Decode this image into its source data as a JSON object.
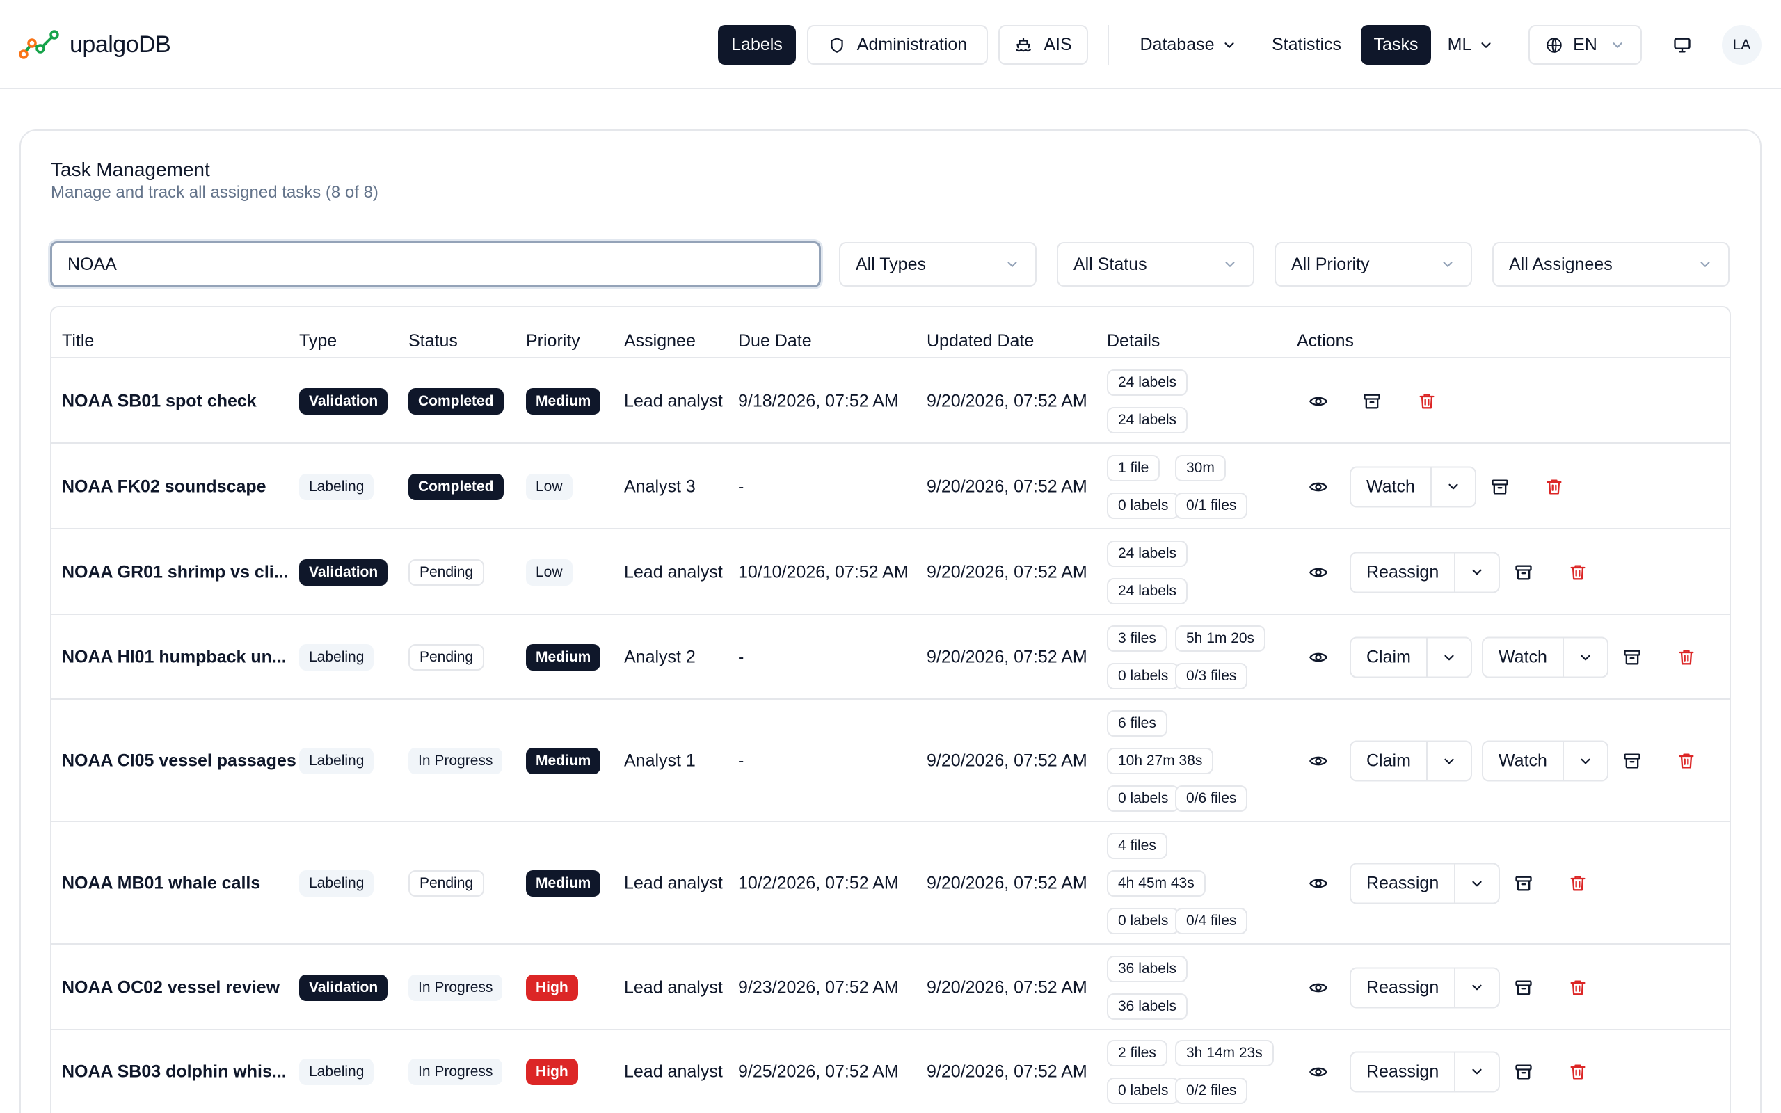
{
  "app": {
    "name": "upalgoDB"
  },
  "nav": {
    "labels": "Labels",
    "administration": "Administration",
    "ais": "AIS",
    "database": "Database",
    "statistics": "Statistics",
    "tasks": "Tasks",
    "ml": "ML",
    "language": "EN",
    "user_initials": "LA"
  },
  "page": {
    "title": "Task Management",
    "subtitle": "Manage and track all assigned tasks (8 of 8)"
  },
  "filters": {
    "search_value": "NOAA",
    "type": "All Types",
    "status": "All Status",
    "priority": "All Priority",
    "assignee": "All Assignees"
  },
  "table": {
    "columns": {
      "title": "Title",
      "type": "Type",
      "status": "Status",
      "priority": "Priority",
      "assignee": "Assignee",
      "due": "Due Date",
      "updated": "Updated Date",
      "details": "Details",
      "actions": "Actions"
    },
    "rows": [
      {
        "title": "NOAA SB01 spot check",
        "type": "Validation",
        "status": "Completed",
        "priority": "Medium",
        "assignee": "Lead analyst",
        "due": "9/18/2026, 07:52 AM",
        "updated": "9/20/2026, 07:52 AM",
        "details": [
          [
            "24 labels"
          ],
          [
            "24 labels"
          ]
        ],
        "actions": []
      },
      {
        "title": "NOAA FK02 soundscape",
        "type": "Labeling",
        "status": "Completed",
        "priority": "Low",
        "assignee": "Analyst 3",
        "due": "-",
        "updated": "9/20/2026, 07:52 AM",
        "details": [
          [
            "1 file",
            "30m"
          ],
          [
            "0 labels",
            "0/1 files"
          ]
        ],
        "actions": [
          "Watch"
        ]
      },
      {
        "title": "NOAA GR01 shrimp vs cli...",
        "type": "Validation",
        "status": "Pending",
        "priority": "Low",
        "assignee": "Lead analyst",
        "due": "10/10/2026, 07:52 AM",
        "updated": "9/20/2026, 07:52 AM",
        "details": [
          [
            "24 labels"
          ],
          [
            "24 labels"
          ]
        ],
        "actions": [
          "Reassign"
        ]
      },
      {
        "title": "NOAA HI01 humpback un...",
        "type": "Labeling",
        "status": "Pending",
        "priority": "Medium",
        "assignee": "Analyst 2",
        "due": "-",
        "updated": "9/20/2026, 07:52 AM",
        "details": [
          [
            "3 files",
            "5h 1m 20s"
          ],
          [
            "0 labels",
            "0/3 files"
          ]
        ],
        "actions": [
          "Claim",
          "Watch"
        ]
      },
      {
        "title": "NOAA CI05 vessel passages",
        "type": "Labeling",
        "status": "In Progress",
        "priority": "Medium",
        "assignee": "Analyst 1",
        "due": "-",
        "updated": "9/20/2026, 07:52 AM",
        "details": [
          [
            "6 files"
          ],
          [
            "10h 27m 38s"
          ],
          [
            "0 labels",
            "0/6 files"
          ]
        ],
        "actions": [
          "Claim",
          "Watch"
        ]
      },
      {
        "title": "NOAA MB01 whale calls",
        "type": "Labeling",
        "status": "Pending",
        "priority": "Medium",
        "assignee": "Lead analyst",
        "due": "10/2/2026, 07:52 AM",
        "updated": "9/20/2026, 07:52 AM",
        "details": [
          [
            "4 files"
          ],
          [
            "4h 45m 43s"
          ],
          [
            "0 labels",
            "0/4 files"
          ]
        ],
        "actions": [
          "Reassign"
        ]
      },
      {
        "title": "NOAA OC02 vessel review",
        "type": "Validation",
        "status": "In Progress",
        "priority": "High",
        "assignee": "Lead analyst",
        "due": "9/23/2026, 07:52 AM",
        "updated": "9/20/2026, 07:52 AM",
        "details": [
          [
            "36 labels"
          ],
          [
            "36 labels"
          ]
        ],
        "actions": [
          "Reassign"
        ]
      },
      {
        "title": "NOAA SB03 dolphin whis...",
        "type": "Labeling",
        "status": "In Progress",
        "priority": "High",
        "assignee": "Lead analyst",
        "due": "9/25/2026, 07:52 AM",
        "updated": "9/20/2026, 07:52 AM",
        "details": [
          [
            "2 files",
            "3h 14m 23s"
          ],
          [
            "0 labels",
            "0/2 files"
          ]
        ],
        "actions": [
          "Reassign"
        ]
      }
    ]
  },
  "colors": {
    "primary": "#0f172a",
    "danger": "#dc2626",
    "muted_text": "#64748b",
    "border": "#e5e7eb",
    "logo_green": "#16a34a",
    "logo_orange": "#f97316"
  }
}
